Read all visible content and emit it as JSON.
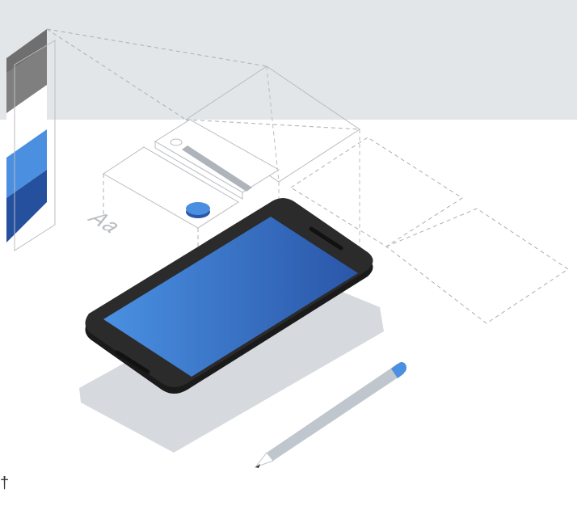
{
  "illustration": {
    "aa_label": "Aa",
    "corner_glyph": "†"
  },
  "colors": {
    "top_band": "#e3e6e9",
    "wireframe": "#b8bcc1",
    "dashed": "#aab0b6",
    "phone_body": "#2b2b2b",
    "phone_edge": "#1a1a1a",
    "screen_light": "#4a90e2",
    "screen_dark": "#2a56a8",
    "shadow": "#d6dadf",
    "accent_blue": "#4a8fe0",
    "swatch_gray_dark": "#6f6f6f",
    "swatch_gray_light": "#a0a0a0",
    "swatch_blue_light": "#4a8fe0",
    "swatch_blue_dark": "#24509e",
    "pencil_body": "#bfc6cd",
    "pencil_tip": "#4a8fe0",
    "slider_track": "#aeb4ba"
  },
  "icons": [
    "phone-illustration",
    "pencil-icon",
    "color-swatch-icon",
    "slider-icon",
    "button-icon",
    "typography-icon"
  ]
}
